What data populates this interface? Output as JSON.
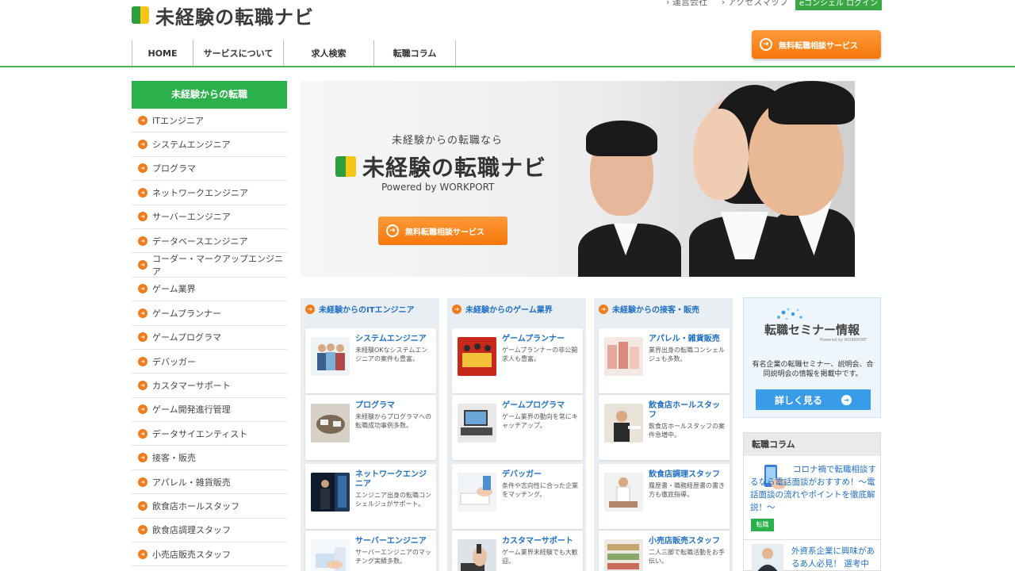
{
  "header": {
    "logo_text": "未経験の転職ナビ",
    "top_links": [
      "運営会社",
      "アクセスマップ"
    ],
    "login_label": "eコンシェル ログイン",
    "nav": [
      "HOME",
      "サービスについて",
      "求人検索",
      "転職コラム"
    ],
    "cta_label": "無料転職相談サービス"
  },
  "sidebar": {
    "title": "未経験からの転職",
    "items": [
      "ITエンジニア",
      "システムエンジニア",
      "プログラマ",
      "ネットワークエンジニア",
      "サーバーエンジニア",
      "データベースエンジニア",
      "コーダー・マークアップエンジニア",
      "ゲーム業界",
      "ゲームプランナー",
      "ゲームプログラマ",
      "デバッガー",
      "カスタマーサポート",
      "ゲーム開発進行管理",
      "データサイエンティスト",
      "接客・販売",
      "アパレル・雑貨販売",
      "飲食店ホールスタッフ",
      "飲食店調理スタッフ",
      "小売店販売スタッフ"
    ]
  },
  "hero": {
    "tagline": "未経験からの転職なら",
    "logo_text": "未経験の転職ナビ",
    "powered": "Powered by WORKPORT",
    "cta_label": "無料転職相談サービス"
  },
  "columns": [
    {
      "heading": "未経験からのITエンジニア",
      "cards": [
        {
          "title": "システムエンジニア",
          "desc": "未経験OKなシステムエンジニアの案件も豊富。"
        },
        {
          "title": "プログラマ",
          "desc": "未経験からプログラマへの転職成功事例多数。"
        },
        {
          "title": "ネットワークエンジニア",
          "desc": "エンジニア出身の転職コンシェルジュがサポート。"
        },
        {
          "title": "サーバーエンジニア",
          "desc": "サーバーエンジニアのマッチング実績多数。"
        }
      ]
    },
    {
      "heading": "未経験からのゲーム業界",
      "cards": [
        {
          "title": "ゲームプランナー",
          "desc": "ゲームプランナーの非公開求人も豊富。"
        },
        {
          "title": "ゲームプログラマ",
          "desc": "ゲーム業界の動向を常にキャッチアップ。"
        },
        {
          "title": "デバッガー",
          "desc": "条件や志向性に合った企業をマッチング。"
        },
        {
          "title": "カスタマーサポート",
          "desc": "ゲーム業界未経験でも大歓迎。"
        }
      ]
    },
    {
      "heading": "未経験からの接客・販売",
      "cards": [
        {
          "title": "アパレル・雑貨販売",
          "desc": "業界出身の転職コンシェルジュも多数。"
        },
        {
          "title": "飲食店ホールスタッフ",
          "desc": "飲食店ホールスタッフの案件急増中。"
        },
        {
          "title": "飲食店調理スタッフ",
          "desc": "履歴書・職務経歴書の書き方も徹底指導。"
        },
        {
          "title": "小売店販売スタッフ",
          "desc": "二人三脚で転職活動をお手伝い。"
        }
      ]
    }
  ],
  "seminar": {
    "title": "転職セミナー情報",
    "powered": "Powered by WORKPORT",
    "desc": "有名企業の転職セミナー、説明会、合同説明会の情報を掲載中です。",
    "button_label": "詳しく見る"
  },
  "column_box": {
    "heading": "転職コラム",
    "articles": [
      {
        "text": "コロナ禍で転職相談するなら電話面談がおすすめ！～電話面談の流れやポイントを徹底解説！～",
        "tag": "転職"
      },
      {
        "text": "外資系企業に興味があるあ人必見！ 選考中に"
      }
    ]
  },
  "colors": {
    "green": "#2bb14b",
    "orange": "#f6770a",
    "blue": "#1f6fc4"
  }
}
